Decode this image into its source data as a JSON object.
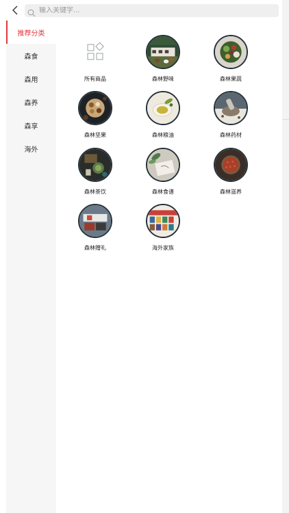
{
  "search": {
    "placeholder": "输入关键字..."
  },
  "sidebar": {
    "items": [
      {
        "label": "推荐分类"
      },
      {
        "label": "森食"
      },
      {
        "label": "森用"
      },
      {
        "label": "森养"
      },
      {
        "label": "森享"
      },
      {
        "label": "海外"
      }
    ]
  },
  "categories": [
    {
      "label": "所有商品",
      "icon": "grid-icon"
    },
    {
      "label": "森林野味"
    },
    {
      "label": "森林果蔬"
    },
    {
      "label": "森林坚果"
    },
    {
      "label": "森林粮油"
    },
    {
      "label": "森林药材"
    },
    {
      "label": "森林茶饮"
    },
    {
      "label": "森林食谱"
    },
    {
      "label": "森林滋养"
    },
    {
      "label": "森林赠礼"
    },
    {
      "label": "海外家族"
    }
  ],
  "colors": {
    "accent": "#e2373b",
    "sidebar_bg": "#f6f6f6",
    "search_bg": "#efefef"
  }
}
